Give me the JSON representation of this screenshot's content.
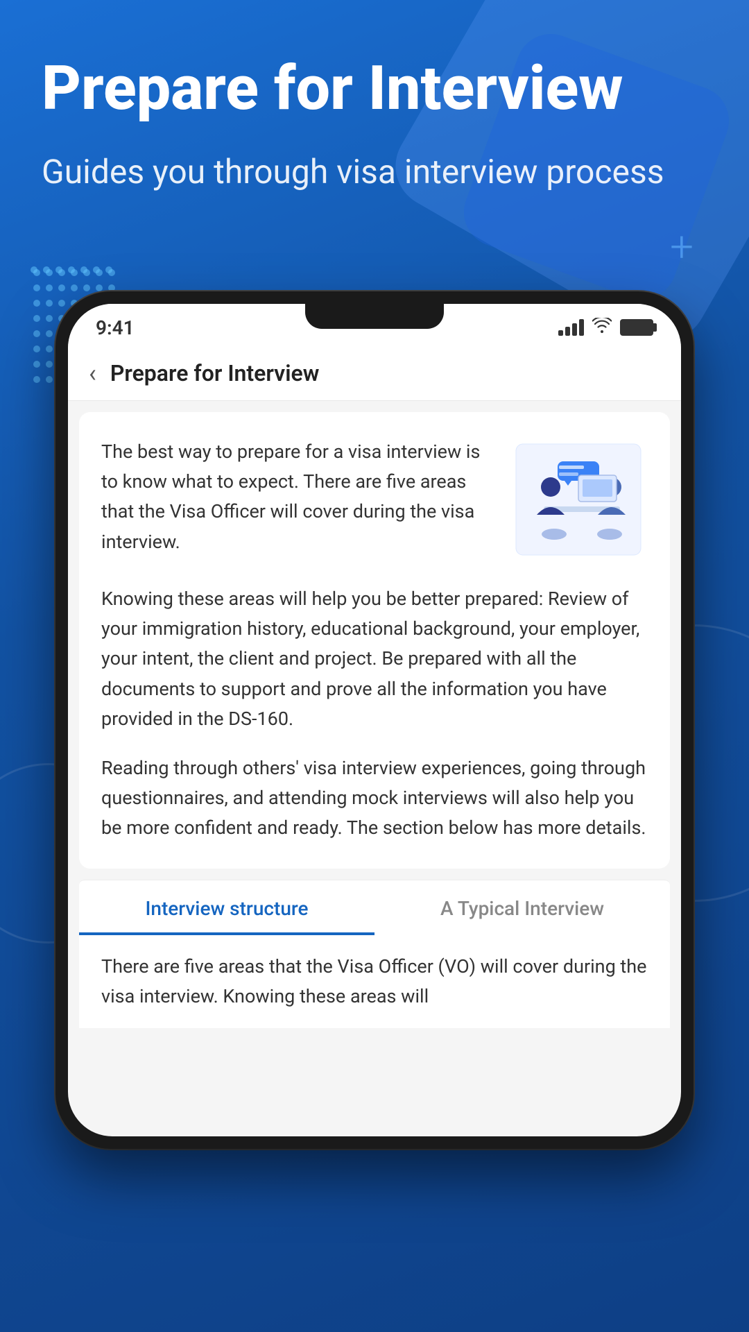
{
  "background": {
    "color_primary": "#1565c0",
    "color_secondary": "#0e3f85"
  },
  "header": {
    "title": "Prepare for Interview",
    "subtitle": "Guides you through visa interview process"
  },
  "phone": {
    "status_bar": {
      "time": "9:41"
    },
    "navbar": {
      "back_label": "‹",
      "title": "Prepare for Interview"
    },
    "content": {
      "paragraph1": "The best way to prepare for a visa interview is to know what to expect. There are five areas that the Visa Officer will cover during the visa interview.",
      "paragraph2": "Knowing these areas will help you be better prepared: Review of your immigration history, educational background, your employer, your intent, the client and project. Be prepared with all the documents to support and prove all the information you have provided in the DS-160.",
      "paragraph3": "Reading through others' visa interview experiences, going through questionnaires, and attending mock interviews will also help you be more confident and ready. The section below has more details."
    },
    "tabs": [
      {
        "label": "Interview structure",
        "active": true
      },
      {
        "label": "A Typical Interview",
        "active": false
      }
    ],
    "bottom_text": "There are five areas that the Visa Officer (VO) will cover during the visa interview. Knowing these areas will"
  },
  "dot_grid": {
    "rows": 7,
    "cols": 8
  }
}
